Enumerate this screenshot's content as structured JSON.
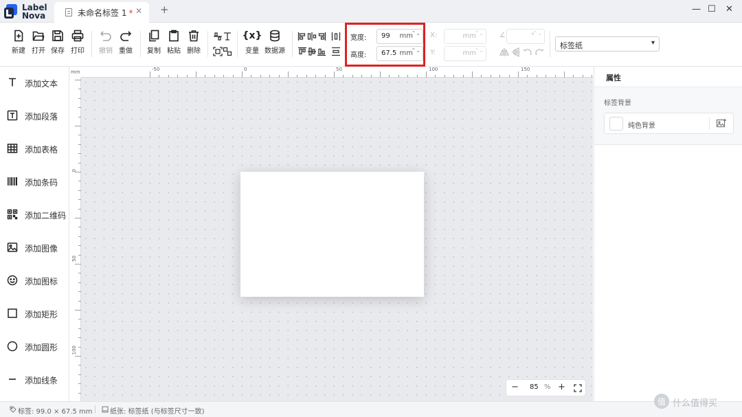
{
  "app": {
    "logo_line1": "Label",
    "logo_line2": "Nova",
    "tab_title": "未命名标签 1",
    "tab_modified": "*",
    "tab_close": "✕",
    "new_tab": "+",
    "win_min": "—",
    "win_max": "☐",
    "win_close": "✕"
  },
  "toolbar": {
    "new": "新建",
    "open": "打开",
    "save": "保存",
    "print": "打印",
    "undo": "撤销",
    "redo": "重做",
    "copy": "复制",
    "paste": "粘贴",
    "delete": "删除",
    "variable": "变量",
    "datasource": "数据源",
    "variable_symbol": "{x}"
  },
  "size": {
    "width_label": "宽度:",
    "width_value": "99",
    "height_label": "高度:",
    "height_value": "67.5",
    "unit": "mm",
    "spin": "⌃⌄"
  },
  "position": {
    "x_label": "X:",
    "y_label": "Y:",
    "unit": "mm",
    "angle_symbol": "∠",
    "angle_unit": "°"
  },
  "paper_select": {
    "value": "标签纸",
    "caret": "▾"
  },
  "sidebar": {
    "items": [
      {
        "label": "添加文本",
        "icon": "text-icon"
      },
      {
        "label": "添加段落",
        "icon": "paragraph-icon"
      },
      {
        "label": "添加表格",
        "icon": "table-icon"
      },
      {
        "label": "添加条码",
        "icon": "barcode-icon"
      },
      {
        "label": "添加二维码",
        "icon": "qrcode-icon"
      },
      {
        "label": "添加图像",
        "icon": "image-icon"
      },
      {
        "label": "添加图标",
        "icon": "emoji-icon"
      },
      {
        "label": "添加矩形",
        "icon": "rectangle-icon"
      },
      {
        "label": "添加圆形",
        "icon": "circle-icon"
      },
      {
        "label": "添加线条",
        "icon": "line-icon"
      }
    ]
  },
  "ruler": {
    "unit": "mm",
    "h_labels": [
      "-50",
      "0",
      "50",
      "100",
      "150"
    ],
    "v_labels": [
      "0",
      "50",
      "100"
    ]
  },
  "zoom": {
    "value": "85",
    "percent": "%",
    "minus": "−",
    "plus": "+"
  },
  "panel": {
    "title": "属性",
    "section_title": "标签背景",
    "background_value": "纯色背景"
  },
  "status": {
    "label_info": "标签: 99.0 × 67.5 mm",
    "paper_info": "纸张: 标签纸 (与标签尺寸一致)"
  },
  "watermark": {
    "text": "什么值得买"
  },
  "colors": {
    "accent": "#2563eb",
    "highlight_box": "#e02020",
    "modified_star": "#e53935",
    "canvas_bg": "#e9eaee"
  }
}
